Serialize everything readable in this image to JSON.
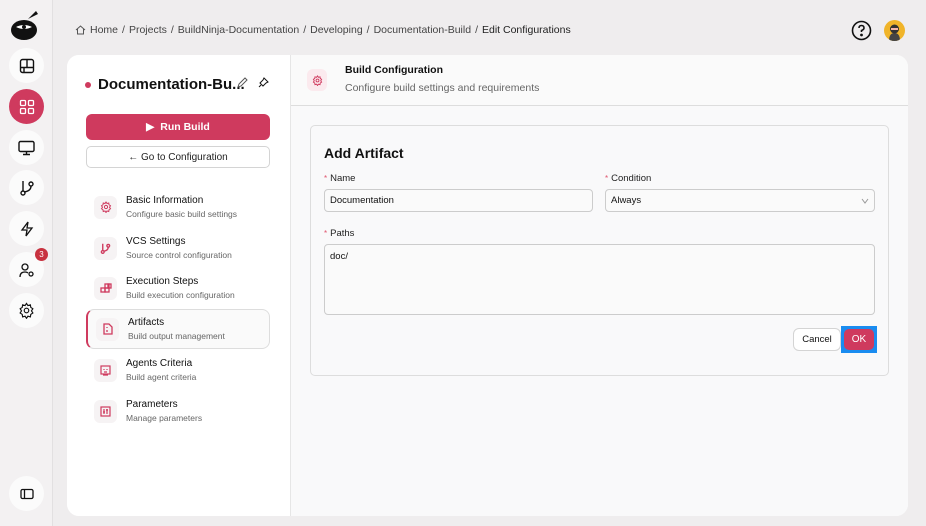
{
  "rail": {
    "items": [
      "dashboard",
      "projects",
      "monitor",
      "vcs",
      "actions",
      "users",
      "settings"
    ],
    "badge": "3"
  },
  "breadcrumb": [
    "Home",
    "Projects",
    "BuildNinja-Documentation",
    "Developing",
    "Documentation-Build",
    "Edit Configurations"
  ],
  "sidebar": {
    "title": "Documentation-Bu...",
    "run_build": "Run Build",
    "go_config": "← Go to Configuration",
    "items": [
      {
        "title": "Basic Information",
        "subtitle": "Configure basic build settings"
      },
      {
        "title": "VCS Settings",
        "subtitle": "Source control configuration"
      },
      {
        "title": "Execution Steps",
        "subtitle": "Build execution configuration"
      },
      {
        "title": "Artifacts",
        "subtitle": "Build output management"
      },
      {
        "title": "Agents Criteria",
        "subtitle": "Build agent criteria"
      },
      {
        "title": "Parameters",
        "subtitle": "Manage parameters"
      }
    ]
  },
  "header": {
    "title": "Build Configuration",
    "subtitle": "Configure build settings and requirements"
  },
  "form": {
    "title": "Add Artifact",
    "name_label": "Name",
    "name_value": "Documentation",
    "condition_label": "Condition",
    "condition_value": "Always",
    "paths_label": "Paths",
    "paths_value": "doc/",
    "required": "*",
    "cancel": "Cancel",
    "ok": "OK"
  },
  "colors": {
    "accent": "#cf3a5e",
    "focus": "#1a8cf0"
  }
}
